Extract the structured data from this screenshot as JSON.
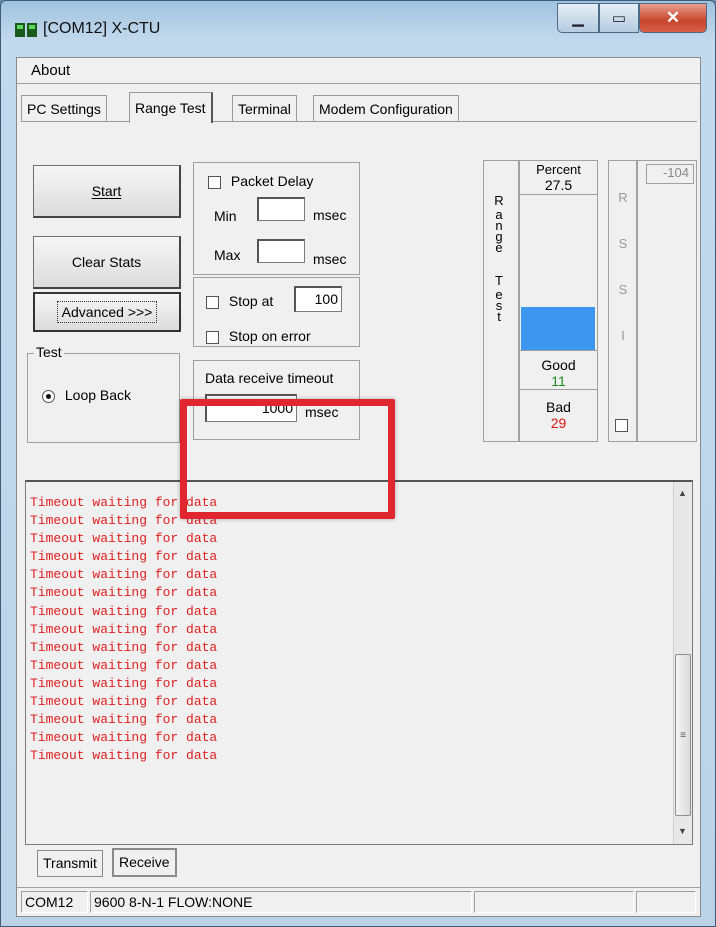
{
  "window": {
    "title": "[COM12] X-CTU"
  },
  "menu": {
    "about": "About"
  },
  "tabs": [
    {
      "label": "PC Settings"
    },
    {
      "label": "Range Test",
      "active": true
    },
    {
      "label": "Terminal"
    },
    {
      "label": "Modem Configuration"
    }
  ],
  "buttons": {
    "start": "Start",
    "clear_stats": "Clear Stats",
    "advanced": "Advanced >>>"
  },
  "packet_delay": {
    "label": "Packet Delay",
    "checked": false,
    "min_label": "Min",
    "max_label": "Max",
    "min_value": "",
    "max_value": "",
    "unit": "msec"
  },
  "stop": {
    "stop_at_label": "Stop at",
    "stop_at_value": "100",
    "stop_on_error_label": "Stop on error"
  },
  "timeout": {
    "label": "Data receive timeout",
    "value": "1000",
    "unit": "msec"
  },
  "test_group": {
    "label": "Test",
    "option": "Loop Back"
  },
  "range_test": {
    "vertical_label": "Range Test",
    "percent_label": "Percent",
    "percent_value": "27.5",
    "fill_fraction": 0.275,
    "good_label": "Good",
    "good_value": "11",
    "bad_label": "Bad",
    "bad_value": "29",
    "bar_color": "#3d96f0",
    "good_color": "#1a8a1a",
    "bad_color": "#e01010"
  },
  "rssi": {
    "value": "-104",
    "vertical_label": "RSSI"
  },
  "log": {
    "color": "#e02020",
    "lines": [
      "Timeout waiting for data",
      "Timeout waiting for data",
      "Timeout waiting for data",
      "Timeout waiting for data",
      "Timeout waiting for data",
      "Timeout waiting for data",
      "Timeout waiting for data",
      "Timeout waiting for data",
      "Timeout waiting for data",
      "Timeout waiting for data",
      "Timeout waiting for data",
      "Timeout waiting for data",
      "Timeout waiting for data",
      "Timeout waiting for data",
      "Timeout waiting for data"
    ]
  },
  "bottom_tabs": {
    "transmit": "Transmit",
    "receive": "Receive"
  },
  "status": {
    "port": "COM12",
    "settings": "9600 8-N-1  FLOW:NONE"
  },
  "highlight_color": "#e0262e"
}
